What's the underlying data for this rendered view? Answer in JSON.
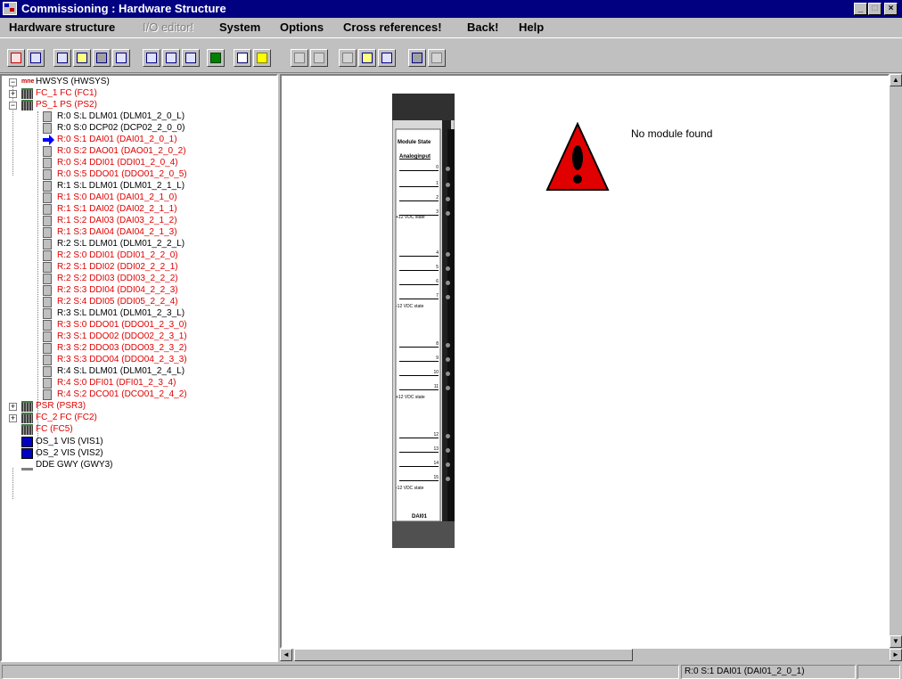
{
  "window": {
    "title": "Commissioning : Hardware Structure"
  },
  "menu": [
    {
      "label": "Hardware structure",
      "enabled": true
    },
    {
      "label": "I/O editor!",
      "enabled": false
    },
    {
      "label": "System",
      "enabled": true
    },
    {
      "label": "Options",
      "enabled": true
    },
    {
      "label": "Cross references!",
      "enabled": true
    },
    {
      "label": "Back!",
      "enabled": true
    },
    {
      "label": "Help",
      "enabled": true
    }
  ],
  "toolbar": {
    "buttons": [
      "edit-icon",
      "window-icon",
      "view1-icon",
      "view2-icon",
      "view3-icon",
      "view4-icon",
      "list1-icon",
      "list2-icon",
      "list3-icon",
      "back-arrow-icon",
      "print-icon",
      "help-icon",
      "move-icon",
      "star-icon",
      "tree1-icon",
      "tree2-icon",
      "net-icon",
      "bin1-icon",
      "bin2-icon"
    ]
  },
  "tree": {
    "root": "HWSYS (HWSYS)",
    "items": [
      {
        "label": "FC_1  FC (FC1)",
        "color": "red",
        "level": 1
      },
      {
        "label": "PS_1  PS (PS2)",
        "color": "red",
        "level": 1
      },
      {
        "label": "R:0 S:L  DLM01 (DLM01_2_0_L)",
        "color": "black",
        "level": 2
      },
      {
        "label": "R:0 S:0  DCP02 (DCP02_2_0_0)",
        "color": "black",
        "level": 2
      },
      {
        "label": "R:0 S:1  DAI01 (DAI01_2_0_1)",
        "color": "red",
        "level": 2
      },
      {
        "label": "R:0 S:2  DAO01 (DAO01_2_0_2)",
        "color": "red",
        "level": 2
      },
      {
        "label": "R:0 S:4  DDI01 (DDI01_2_0_4)",
        "color": "red",
        "level": 2
      },
      {
        "label": "R:0 S:5  DDO01 (DDO01_2_0_5)",
        "color": "red",
        "level": 2
      },
      {
        "label": "R:1 S:L  DLM01 (DLM01_2_1_L)",
        "color": "black",
        "level": 2
      },
      {
        "label": "R:1 S:0  DAI01 (DAI01_2_1_0)",
        "color": "red",
        "level": 2
      },
      {
        "label": "R:1 S:1  DAI02 (DAI02_2_1_1)",
        "color": "red",
        "level": 2
      },
      {
        "label": "R:1 S:2  DAI03 (DAI03_2_1_2)",
        "color": "red",
        "level": 2
      },
      {
        "label": "R:1 S:3  DAI04 (DAI04_2_1_3)",
        "color": "red",
        "level": 2
      },
      {
        "label": "R:2 S:L  DLM01 (DLM01_2_2_L)",
        "color": "black",
        "level": 2
      },
      {
        "label": "R:2 S:0  DDI01 (DDI01_2_2_0)",
        "color": "red",
        "level": 2
      },
      {
        "label": "R:2 S:1  DDI02 (DDI02_2_2_1)",
        "color": "red",
        "level": 2
      },
      {
        "label": "R:2 S:2  DDI03 (DDI03_2_2_2)",
        "color": "red",
        "level": 2
      },
      {
        "label": "R:2 S:3  DDI04 (DDI04_2_2_3)",
        "color": "red",
        "level": 2
      },
      {
        "label": "R:2 S:4  DDI05 (DDI05_2_2_4)",
        "color": "red",
        "level": 2
      },
      {
        "label": "R:3 S:L  DLM01 (DLM01_2_3_L)",
        "color": "black",
        "level": 2
      },
      {
        "label": "R:3 S:0  DDO01 (DDO01_2_3_0)",
        "color": "red",
        "level": 2
      },
      {
        "label": "R:3 S:1  DDO02 (DDO02_2_3_1)",
        "color": "red",
        "level": 2
      },
      {
        "label": "R:3 S:2  DDO03 (DDO03_2_3_2)",
        "color": "red",
        "level": 2
      },
      {
        "label": "R:3 S:3  DDO04 (DDO04_2_3_3)",
        "color": "red",
        "level": 2
      },
      {
        "label": "R:4 S:L  DLM01 (DLM01_2_4_L)",
        "color": "black",
        "level": 2
      },
      {
        "label": "R:4 S:0  DFI01 (DFI01_2_3_4)",
        "color": "red",
        "level": 2
      },
      {
        "label": "R:4 S:2  DCO01 (DCO01_2_4_2)",
        "color": "red",
        "level": 2
      },
      {
        "label": "PSR (PSR3)",
        "color": "red",
        "level": 1
      },
      {
        "label": "FC_2  FC (FC2)",
        "color": "red",
        "level": 1
      },
      {
        "label": "FC (FC5)",
        "color": "red",
        "level": 1
      },
      {
        "label": "OS_1  VIS (VIS1)",
        "color": "black",
        "level": 1
      },
      {
        "label": "OS_2  VIS (VIS2)",
        "color": "black",
        "level": 1
      },
      {
        "label": "DDE  GWY (GWY3)",
        "color": "black",
        "level": 1
      }
    ]
  },
  "module": {
    "state_label": "Module State",
    "input_label": "Analoginput",
    "vdc_label": "+12 VDC state",
    "vdc_label_neg": "-12 VDC state",
    "channels": [
      "0",
      "1",
      "2",
      "3",
      "4",
      "5",
      "6",
      "7",
      "8",
      "9",
      "10",
      "11",
      "12",
      "13",
      "14",
      "15"
    ],
    "name": "DAI01"
  },
  "message": "No module found",
  "statusbar": {
    "text": "R:0 S:1  DAI01 (DAI01_2_0_1)"
  },
  "colors": {
    "titlebar": "#000080",
    "tree_red": "#e00000",
    "warning_red": "#e00000",
    "selected_arrow": "#0000ff"
  }
}
